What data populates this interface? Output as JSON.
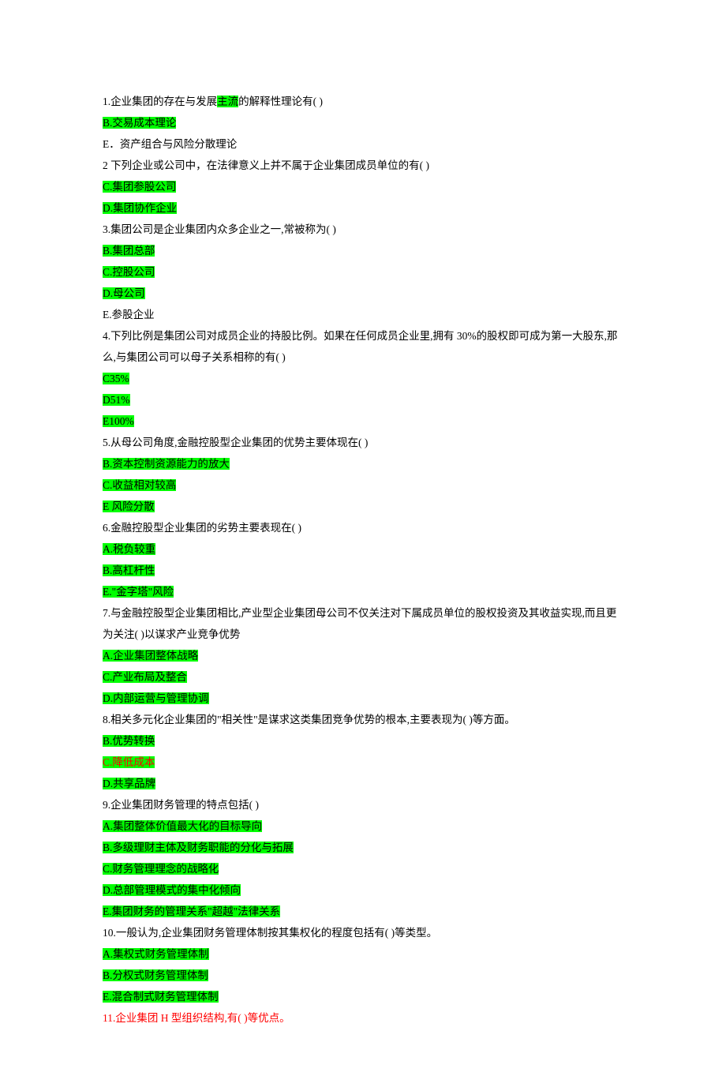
{
  "questions": [
    {
      "parts": [
        {
          "t": "1.企业集团的存在与发展",
          "style": "plain"
        },
        {
          "t": "主流",
          "style": "hl"
        },
        {
          "t": "的解释性理论有( )",
          "style": "plain"
        }
      ],
      "options": [
        {
          "t": "B.交易成本理论",
          "style": "hl"
        },
        {
          "t": "E．资产组合与风险分散理论",
          "style": "plain"
        }
      ]
    },
    {
      "stem": "2 下列企业或公司中，在法律意义上并不属于企业集团成员单位的有( )",
      "options": [
        {
          "t": "C.集团参股公司",
          "style": "hl"
        },
        {
          "t": "D.集团协作企业",
          "style": "hl"
        }
      ]
    },
    {
      "stem": "3.集团公司是企业集团内众多企业之一,常被称为( )",
      "options": [
        {
          "t": "B.集团总部",
          "style": "hl"
        },
        {
          "t": "C.控股公司",
          "style": "hl"
        },
        {
          "t": "D.母公司",
          "style": "hl"
        },
        {
          "t": "E.参股企业",
          "style": "plain"
        }
      ]
    },
    {
      "stem": "4.下列比例是集团公司对成员企业的持股比例。如果在任何成员企业里,拥有 30%的股权即可成为第一大股东,那么,与集团公司可以母子关系相称的有( )",
      "options": [
        {
          "t": "C35%",
          "style": "hl"
        },
        {
          "t": "D51%",
          "style": "hl"
        },
        {
          "t": "E100%",
          "style": "hl"
        }
      ]
    },
    {
      "stem": "5.从母公司角度,金融控股型企业集团的优势主要体现在( )",
      "options": [
        {
          "t": "B.资本控制资源能力的放大",
          "style": "hl"
        },
        {
          "t": "C.收益相对较高",
          "style": "hl"
        },
        {
          "t": "E 风险分散",
          "style": "hl"
        }
      ]
    },
    {
      "stem": "6.金融控股型企业集团的劣势主要表现在( )",
      "options": [
        {
          "t": "A.税负较重",
          "style": "hl"
        },
        {
          "t": "B.高杠杆性",
          "style": "hl"
        },
        {
          "t": "E.\"金字塔\"风险",
          "style": "hl"
        }
      ]
    },
    {
      "stem": "7.与金融控股型企业集团相比,产业型企业集团母公司不仅关注对下属成员单位的股权投资及其收益实现,而且更为关注( )以谋求产业竞争优势",
      "options": [
        {
          "t": "A.企业集团整体战略",
          "style": "hl"
        },
        {
          "t": "C.产业布局及整合",
          "style": "hl"
        },
        {
          "t": "D.内部运营与管理协调",
          "style": "hl"
        }
      ]
    },
    {
      "stem": "8.相关多元化企业集团的\"相关性\"是谋求这类集团竞争优势的根本,主要表现为( )等方面。",
      "options": [
        {
          "t": "B.优势转换",
          "style": "hl"
        },
        {
          "t": "C.降低成本",
          "style": "hl-red"
        },
        {
          "t": "D.共享品牌",
          "style": "hl"
        }
      ]
    },
    {
      "stem": "9.企业集团财务管理的特点包括( )",
      "options": [
        {
          "t": "A.集团整体价值最大化的目标导向",
          "style": "hl"
        },
        {
          "t": "B.多级理财主体及财务职能的分化与拓展",
          "style": "hl"
        },
        {
          "t": "C.财务管理理念的战略化",
          "style": "hl"
        },
        {
          "t": "D.总部管理模式的集中化倾向",
          "style": "hl"
        },
        {
          "t": "E.集团财务的管理关系\"超越\"法律关系",
          "style": "hl"
        }
      ]
    },
    {
      "stem": "10.一般认为,企业集团财务管理体制按其集权化的程度包括有( )等类型。",
      "options": [
        {
          "t": "A.集权式财务管理体制",
          "style": "hl"
        },
        {
          "t": "B.分权式财务管理体制",
          "style": "hl"
        },
        {
          "t": "E.混合制式财务管理体制",
          "style": "hl"
        }
      ]
    },
    {
      "stem": "11.企业集团 H 型组织结构,有( )等优点。",
      "stem_style": "red",
      "options": []
    }
  ]
}
